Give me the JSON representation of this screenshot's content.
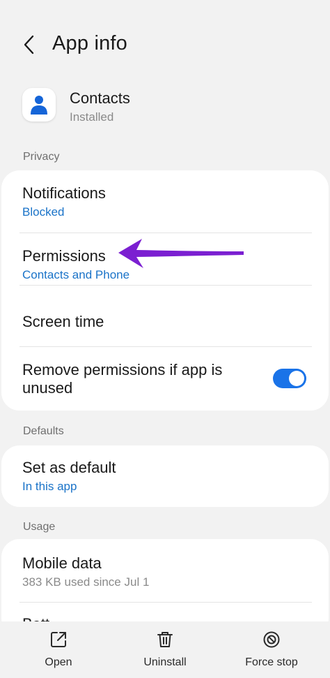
{
  "header": {
    "title": "App info"
  },
  "app": {
    "name": "Contacts",
    "status": "Installed"
  },
  "sections": {
    "privacy": "Privacy",
    "defaults": "Defaults",
    "usage": "Usage"
  },
  "privacy": {
    "notifications": {
      "title": "Notifications",
      "sub": "Blocked"
    },
    "permissions": {
      "title": "Permissions",
      "sub": "Contacts and Phone"
    },
    "screen_time": {
      "title": "Screen time"
    },
    "remove_permissions": {
      "title_line1": "Remove permissions if app is",
      "title_line2": "unused",
      "enabled": true
    }
  },
  "defaults": {
    "set_default": {
      "title": "Set as default",
      "sub": "In this app"
    }
  },
  "usage": {
    "mobile_data": {
      "title": "Mobile data",
      "sub": "383 KB used since Jul 1"
    },
    "battery": {
      "title_partial": "Batt"
    }
  },
  "bottom": {
    "open": "Open",
    "uninstall": "Uninstall",
    "force_stop": "Force stop"
  },
  "colors": {
    "accent": "#1a73c8",
    "toggle": "#1a73e8",
    "annotation_arrow": "#7b1fd1"
  },
  "icons": {
    "back": "chevron-left-icon",
    "app": "person-icon",
    "open": "open-external-icon",
    "uninstall": "trash-icon",
    "force_stop": "block-icon"
  }
}
